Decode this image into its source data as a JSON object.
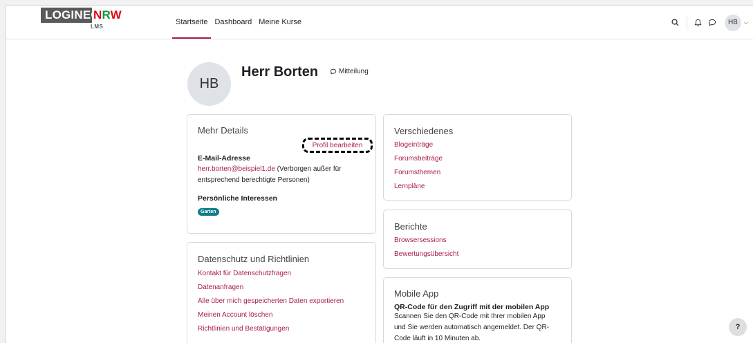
{
  "logo": {
    "word1": "LOGINEO",
    "word2a": "N",
    "word2b": "R",
    "word2c": "W",
    "sub": "LMS"
  },
  "nav": {
    "items": [
      {
        "label": "Startseite"
      },
      {
        "label": "Dashboard"
      },
      {
        "label": "Meine Kurse"
      }
    ],
    "user_initials": "HB"
  },
  "profile": {
    "initials": "HB",
    "name": "Herr Borten",
    "message_label": "Mitteilung"
  },
  "details": {
    "title": "Mehr Details",
    "edit_label": "Profil bearbeiten",
    "email_label": "E-Mail-Adresse",
    "email": "herr.borten@beispiel1.de",
    "email_note_1": " (Verborgen außer für",
    "email_note_2": "entsprechend berechtigte Personen)",
    "interests_label": "Persönliche Interessen",
    "interest_badge": "Garten"
  },
  "privacy": {
    "title": "Datenschutz und Richtlinien",
    "links": [
      "Kontakt für Datenschutzfragen",
      "Datenanfragen",
      "Alle über mich gespeicherten Daten exportieren",
      "Meinen Account löschen",
      "Richtlinien und Bestätigungen"
    ]
  },
  "misc": {
    "title": "Verschiedenes",
    "links": [
      "Blogeinträge",
      "Forumsbeiträge",
      "Forumsthemen",
      "Lernpläne"
    ]
  },
  "reports": {
    "title": "Berichte",
    "links": [
      "Browsersessions",
      "Bewertungsübersicht"
    ]
  },
  "mobile": {
    "title": "Mobile App",
    "heading": "QR-Code für den Zugriff mit der mobilen App",
    "line1": "Scannen Sie den QR-Code mit Ihrer mobilen App",
    "line2": "und Sie werden automatisch angemeldet. Der QR-",
    "line3": "Code läuft in 10 Minuten ab."
  },
  "help_label": "?",
  "colors": {
    "accent": "#a61e43",
    "badge": "#0f7d8a"
  }
}
